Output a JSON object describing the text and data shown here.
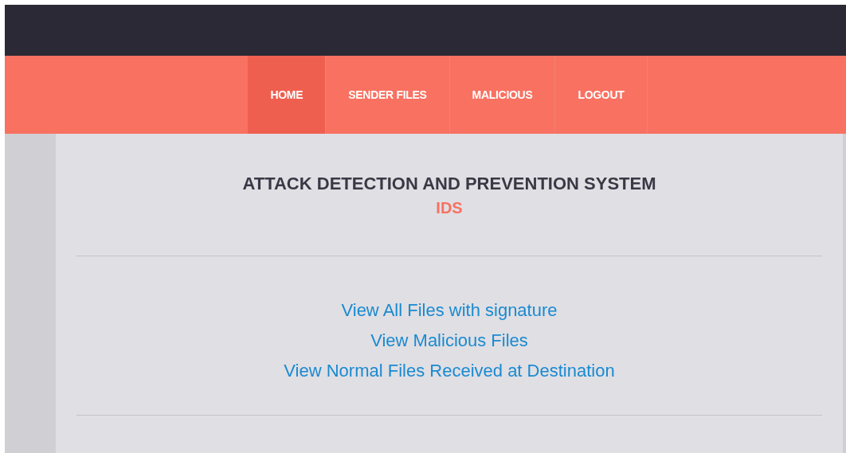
{
  "nav": [
    {
      "label": "HOME",
      "selected": true
    },
    {
      "label": "SENDER FILES",
      "selected": false
    },
    {
      "label": "MALICIOUS",
      "selected": false
    },
    {
      "label": "LOGOUT",
      "selected": false
    }
  ],
  "heading": {
    "title": "ATTACK DETECTION AND PREVENTION SYSTEM",
    "subtitle": "IDS"
  },
  "links": [
    "View All Files with signature",
    "View Malicious Files",
    "View Normal Files Received at Destination"
  ]
}
